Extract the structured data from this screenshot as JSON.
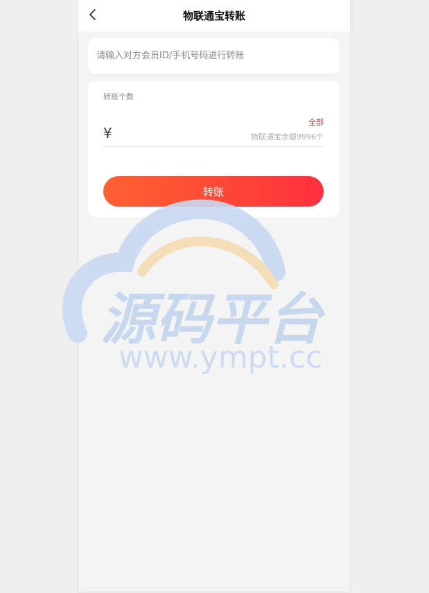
{
  "header": {
    "title": "物联通宝转账",
    "back_icon": "chevron-left-icon"
  },
  "recipient": {
    "placeholder": "请输入对方会员ID/手机号码进行转账",
    "value": ""
  },
  "amount": {
    "label": "转账个数",
    "currency_symbol": "¥",
    "value": "",
    "all_label": "全部",
    "balance_text": "物联通宝余额9996个"
  },
  "actions": {
    "transfer_label": "转账"
  },
  "watermark": {
    "text_cn": "源码平台",
    "text_url": "www.ympt.cc"
  },
  "colors": {
    "accent_red": "#e8292e",
    "button_start": "#fe6032",
    "button_end": "#ff2f3f",
    "watermark_blue": "#c8d8f0",
    "watermark_orange": "#f3dcb4"
  }
}
